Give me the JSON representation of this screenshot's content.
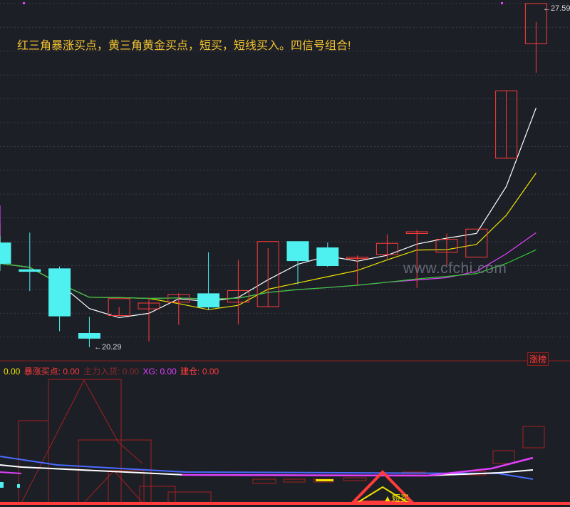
{
  "headline": "红三角暴涨买点，黄三角黄金买点，短买，短线买入。四信号组合!",
  "price_labels": {
    "high": "27.59",
    "low": "20.29"
  },
  "badge": "涨榜",
  "watermark": "www.cfchi.com",
  "short_buy_label": "▲短买",
  "indicator_row": [
    {
      "label": "0.00",
      "color": "#f2e400"
    },
    {
      "label": "暴涨买点: 0.00",
      "color": "#ff3b3b"
    },
    {
      "label": "主力入货: 0.00",
      "color": "#8a2b2b"
    },
    {
      "label": "XG: 0.00",
      "color": "#e040fb"
    },
    {
      "label": "建仓: 0.00",
      "color": "#ff3b3b"
    }
  ],
  "colors": {
    "background": "#1c1f26",
    "up": "#ff3b3b",
    "down": "#4ff0f0",
    "ma_white": "#ffffff",
    "ma_yellow": "#f2e400",
    "ma_green": "#33cc33",
    "ma_magenta": "#e040fb"
  },
  "chart_data": {
    "type": "candlestick",
    "y_range": [
      20.0,
      28.0
    ],
    "high_marker": 27.59,
    "low_marker": 20.29,
    "candles": [
      {
        "o": 22.63,
        "h": 22.8,
        "c": 22.17,
        "l": 22.0
      },
      {
        "o": 22.03,
        "h": 22.86,
        "c": 21.99,
        "l": 21.55
      },
      {
        "o": 22.05,
        "h": 22.1,
        "c": 20.99,
        "l": 20.65
      },
      {
        "o": 20.6,
        "h": 20.97,
        "c": 20.49,
        "l": 20.29
      },
      {
        "o": 21.0,
        "h": 21.19,
        "c": 21.38,
        "l": 21.0
      },
      {
        "o": 21.15,
        "h": 21.4,
        "c": 21.28,
        "l": 20.42
      },
      {
        "o": 21.3,
        "h": 21.5,
        "c": 21.47,
        "l": 20.79
      },
      {
        "o": 21.49,
        "h": 22.42,
        "c": 21.19,
        "l": 21.12
      },
      {
        "o": 21.3,
        "h": 22.25,
        "c": 21.56,
        "l": 20.8
      },
      {
        "o": 21.2,
        "h": 22.51,
        "c": 22.66,
        "l": 21.2
      },
      {
        "o": 22.66,
        "h": 22.66,
        "c": 22.23,
        "l": 21.7
      },
      {
        "o": 22.52,
        "h": 22.64,
        "c": 22.12,
        "l": 22.09
      },
      {
        "o": 22.31,
        "h": 22.35,
        "c": 22.31,
        "l": 21.68
      },
      {
        "o": 22.37,
        "h": 22.82,
        "c": 22.62,
        "l": 22.27
      },
      {
        "o": 22.84,
        "h": 22.92,
        "c": 22.88,
        "l": 21.62
      },
      {
        "o": 22.42,
        "h": 22.84,
        "c": 22.71,
        "l": 22.12
      },
      {
        "o": 22.31,
        "h": 22.31,
        "c": 22.94,
        "l": 22.31
      },
      {
        "o": 24.53,
        "h": 26.04,
        "c": 26.04,
        "l": 24.53
      },
      {
        "o": 27.1,
        "h": 27.59,
        "c": 28.0,
        "l": 26.45
      }
    ]
  }
}
